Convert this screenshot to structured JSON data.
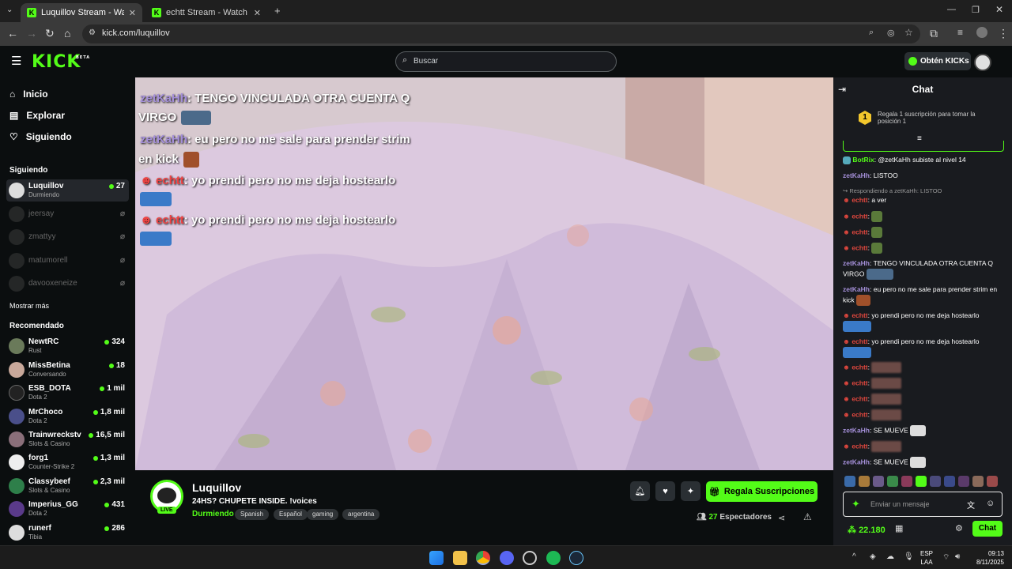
{
  "browser": {
    "tabs": [
      {
        "title": "Luquillov Stream - Watch Live o",
        "active": true
      },
      {
        "title": "echtt Stream - Watch Live on K",
        "active": false
      }
    ],
    "url": "kick.com/luquillov"
  },
  "header": {
    "logo": "KICK",
    "logo_badge": "BETA",
    "search_placeholder": "Buscar",
    "get_kicks_label": "Obtén KICKs"
  },
  "sidebar": {
    "nav": [
      {
        "label": "Inicio",
        "icon": "home-icon"
      },
      {
        "label": "Explorar",
        "icon": "browse-icon"
      },
      {
        "label": "Siguiendo",
        "icon": "heart-icon"
      }
    ],
    "following_title": "Siguiendo",
    "following": [
      {
        "name": "Luquillov",
        "sub": "Durmiendo",
        "viewers": "27",
        "live": true
      },
      {
        "name": "jeersay",
        "live": false
      },
      {
        "name": "zmattyy",
        "live": false
      },
      {
        "name": "matumorell",
        "live": false
      },
      {
        "name": "davooxeneize",
        "live": false
      }
    ],
    "show_more": "Mostrar más",
    "recommended_title": "Recomendado",
    "recommended": [
      {
        "name": "NewtRC",
        "sub": "Rust",
        "viewers": "324"
      },
      {
        "name": "MissBetina",
        "sub": "Conversando",
        "viewers": "18"
      },
      {
        "name": "ESB_DOTA",
        "sub": "Dota 2",
        "viewers": "1 mil"
      },
      {
        "name": "MrChoco",
        "sub": "Dota 2",
        "viewers": "1,8 mil"
      },
      {
        "name": "Trainwreckstv",
        "sub": "Slots & Casino",
        "viewers": "16,5 mil"
      },
      {
        "name": "forg1",
        "sub": "Counter-Strike 2",
        "viewers": "1,3 mil"
      },
      {
        "name": "Classybeef",
        "sub": "Slots & Casino",
        "viewers": "2,3 mil"
      },
      {
        "name": "Imperius_GG",
        "sub": "Dota 2",
        "viewers": "431"
      },
      {
        "name": "runerf",
        "sub": "Tibia",
        "viewers": "286"
      }
    ]
  },
  "video_overlay": [
    {
      "user": "zetKaHh",
      "text": ": TENGO VINCULADA OTRA CUENTA Q",
      "text2": "VIRGO"
    },
    {
      "user": "zetKaHh",
      "text": ": eu pero no me sale para prender strim",
      "text2": "en kick"
    },
    {
      "user": "echtt",
      "text": ": yo prendi pero no me deja hostearlo"
    },
    {
      "user": "echtt",
      "text": ": yo prendi pero no me deja hostearlo"
    }
  ],
  "stream": {
    "channel": "Luquillov",
    "live_badge": "LIVE",
    "title": "24HS? CHUPETE INSIDE. !voices",
    "category": "Durmiendo",
    "tags": [
      "Spanish",
      "Español",
      "gaming",
      "argentina"
    ],
    "gift_label": "Regala Suscripciones",
    "viewers_count": "27",
    "viewers_label": "Espectadores"
  },
  "chat": {
    "title": "Chat",
    "goal_number": "1",
    "goal_text": "Regala 1 suscripción para tomar la posición 1",
    "messages": [
      {
        "user": "BotRix",
        "text": ": @zetKaHh subiste al nivel 14",
        "color": "bot"
      },
      {
        "user": "zetKaHh",
        "text": ": LISTOO",
        "color": "zet"
      },
      {
        "reply": "Respondiendo a zetKaHh: LISTOO"
      },
      {
        "user": "echtt",
        "text": ": a ver",
        "color": "echt"
      },
      {
        "user": "echtt",
        "text": ":",
        "color": "echt"
      },
      {
        "user": "echtt",
        "text": ":",
        "color": "echt"
      },
      {
        "user": "echtt",
        "text": ":",
        "color": "echt"
      },
      {
        "user": "zetKaHh",
        "text": ": TENGO VINCULADA OTRA CUENTA Q VIRGO",
        "color": "zet"
      },
      {
        "user": "zetKaHh",
        "text": ": eu pero no me sale para prender strim en kick",
        "color": "zet"
      },
      {
        "user": "echtt",
        "text": ": yo prendi pero no me deja hostearlo",
        "color": "echt"
      },
      {
        "user": "echtt",
        "text": ": yo prendi pero no me deja hostearlo",
        "color": "echt"
      },
      {
        "user": "echtt",
        "text": ":",
        "color": "echt"
      },
      {
        "user": "echtt",
        "text": ":",
        "color": "echt"
      },
      {
        "user": "echtt",
        "text": ":",
        "color": "echt"
      },
      {
        "user": "echtt",
        "text": ":",
        "color": "echt"
      },
      {
        "user": "zetKaHh",
        "text": ": SE MUEVE",
        "color": "zet"
      },
      {
        "user": "echtt",
        "text": ":",
        "color": "echt"
      },
      {
        "user": "zetKaHh",
        "text": ": SE MUEVE",
        "color": "zet"
      }
    ],
    "input_placeholder": "Enviar un mensaje",
    "kicks_balance": "22.180",
    "send_label": "Chat"
  },
  "taskbar": {
    "lang": "ESP",
    "lang2": "LAA",
    "time": "09:13",
    "date": "8/11/2025"
  },
  "colors": {
    "accent": "#53fc18",
    "bg": "#0b0e0f",
    "chat_bg": "#191b1f"
  }
}
